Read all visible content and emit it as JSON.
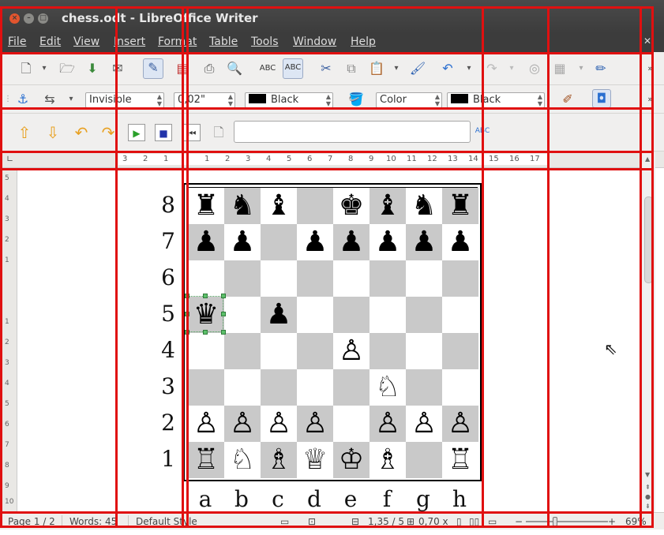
{
  "window": {
    "title": "chess.odt - LibreOffice Writer"
  },
  "menu": [
    "File",
    "Edit",
    "View",
    "Insert",
    "Format",
    "Table",
    "Tools",
    "Window",
    "Help"
  ],
  "toolbar1": {
    "icons": [
      "new-document-icon",
      "open-icon",
      "save-icon",
      "email-icon",
      "edit-mode-icon",
      "export-pdf-icon",
      "print-icon",
      "print-preview-icon",
      "spellcheck-icon",
      "autospellcheck-icon",
      "cut-icon",
      "copy-icon",
      "paste-icon",
      "clone-format-icon",
      "undo-icon",
      "redo-icon",
      "navigator-icon",
      "table-icon",
      "draw-functions-icon"
    ]
  },
  "toolbar2": {
    "line_style": "Invisible",
    "line_width": "0,02\"",
    "line_color": "Black",
    "area_style": "Color",
    "area_color": "Black",
    "swatch_color": "#000000"
  },
  "toolbar3": {
    "find_value": ""
  },
  "ruler": {
    "marks": [
      "3",
      "2",
      "1",
      "1",
      "2",
      "3",
      "4",
      "5",
      "6",
      "7",
      "8",
      "9",
      "10",
      "11",
      "12",
      "13",
      "14",
      "15",
      "16",
      "17"
    ]
  },
  "vruler": {
    "marks": [
      "5",
      "4",
      "3",
      "2",
      "1",
      "1",
      "2",
      "3",
      "4",
      "5",
      "6",
      "7",
      "8",
      "9",
      "10"
    ]
  },
  "board": {
    "ranks": [
      "8",
      "7",
      "6",
      "5",
      "4",
      "3",
      "2",
      "1"
    ],
    "files": [
      "a",
      "b",
      "c",
      "d",
      "e",
      "f",
      "g",
      "h"
    ],
    "rows": [
      [
        "♜",
        "♞",
        "♝",
        "",
        "♚",
        "♝",
        "♞",
        "♜"
      ],
      [
        "♟",
        "♟",
        "",
        "♟",
        "♟",
        "♟",
        "♟",
        "♟"
      ],
      [
        "",
        "",
        "",
        "",
        "",
        "",
        "",
        ""
      ],
      [
        "♛",
        "",
        "♟",
        "",
        "",
        "",
        "",
        ""
      ],
      [
        "",
        "",
        "",
        "",
        "♙",
        "",
        "",
        ""
      ],
      [
        "",
        "",
        "",
        "",
        "",
        "♘",
        "",
        ""
      ],
      [
        "♙",
        "♙",
        "♙",
        "♙",
        "",
        "♙",
        "♙",
        "♙"
      ],
      [
        "♖",
        "♘",
        "♗",
        "♕",
        "♔",
        "♗",
        "",
        "♖"
      ]
    ],
    "dark_color": "#c9c9c9",
    "light_color": "#ffffff"
  },
  "status": {
    "page": "Page 1 / 2",
    "words": "Words: 45",
    "style": "Default Style",
    "position": "1,35 / 5",
    "size": "0,70 x",
    "zoom": "69%"
  }
}
